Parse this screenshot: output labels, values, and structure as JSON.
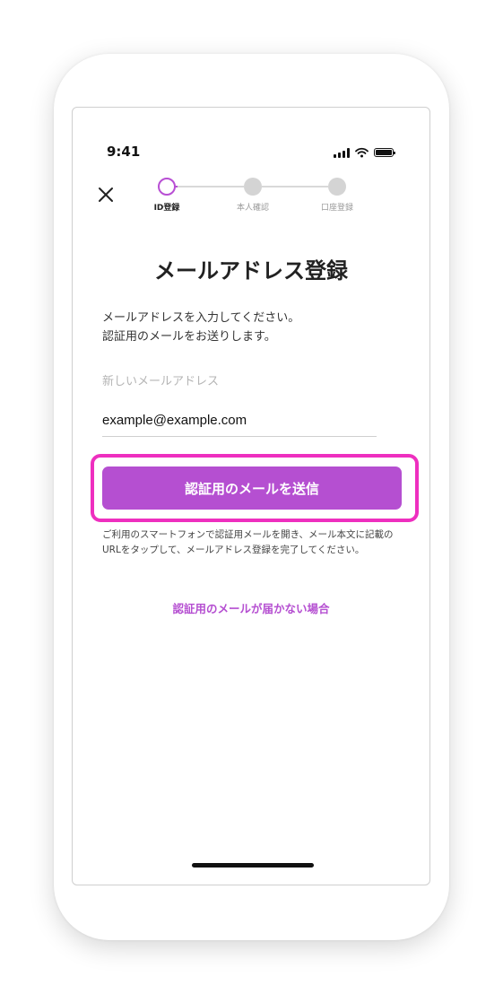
{
  "status_bar": {
    "time": "9:41",
    "icons": [
      "signal-icon",
      "wifi-icon",
      "battery-icon"
    ]
  },
  "nav": {
    "close_icon": "close-icon"
  },
  "stepper": {
    "steps": [
      {
        "label": "ID登録",
        "state": "current"
      },
      {
        "label": "本人確認",
        "state": "pending"
      },
      {
        "label": "口座登録",
        "state": "pending"
      }
    ]
  },
  "page_title": "メールアドレス登録",
  "description": {
    "line1": "メールアドレスを入力してください。",
    "line2": "認証用のメールをお送りします。"
  },
  "email_field": {
    "label": "新しいメールアドレス",
    "value": "example@example.com"
  },
  "send_button_label": "認証用のメールを送信",
  "notice_text": "ご利用のスマートフォンで認証用メールを開き、メール本文に記載のURLをタップして、メールアドレス登録を完了してください。",
  "help_link": "認証用のメールが届かない場合",
  "colors": {
    "accent": "#b54fd1",
    "highlight": "#ee2fbf",
    "step_inactive": "#d4d4d4"
  }
}
